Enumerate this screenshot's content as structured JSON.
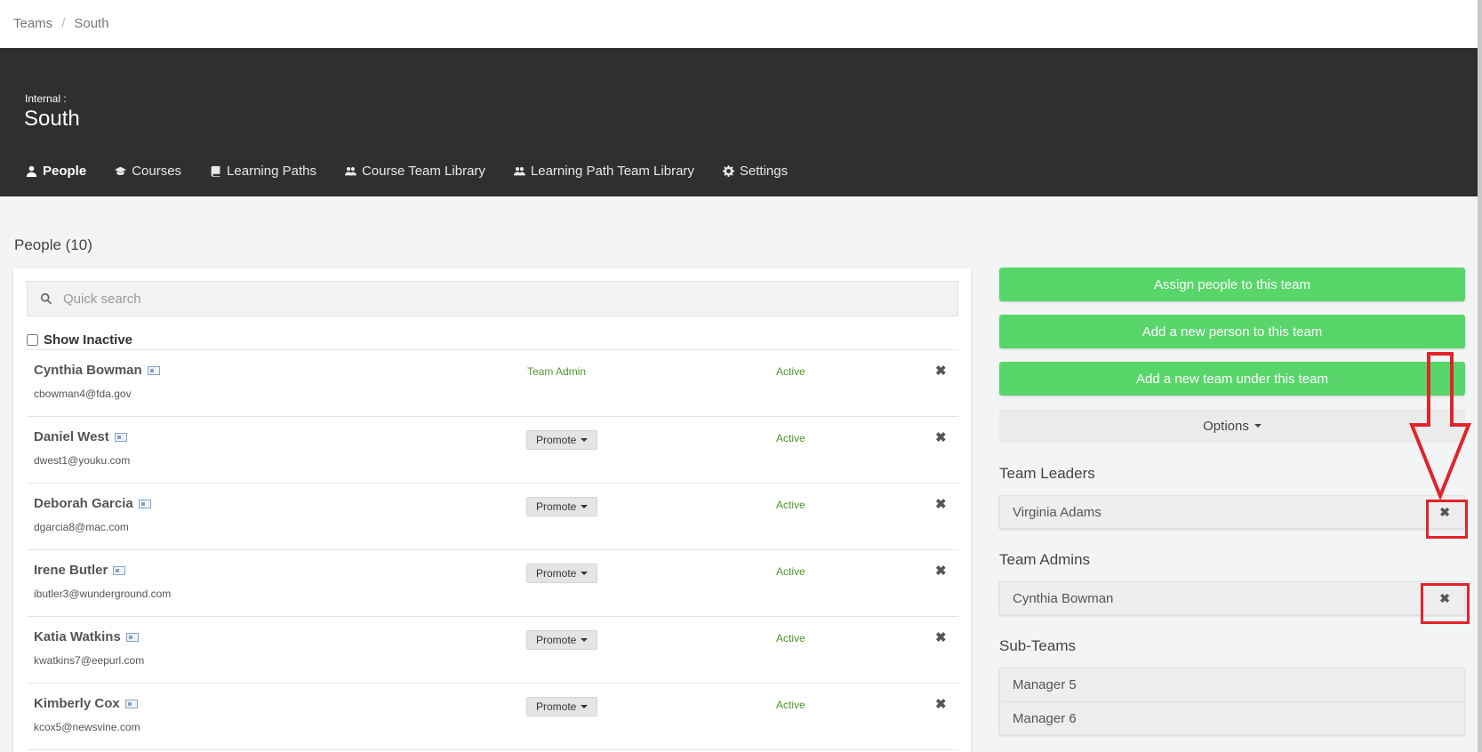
{
  "breadcrumb": {
    "items": [
      "Teams",
      "South"
    ],
    "separator": "/"
  },
  "header": {
    "subtitle": "Internal :",
    "title": "South",
    "tabs": [
      {
        "label": "People",
        "icon": "user-icon",
        "active": true
      },
      {
        "label": "Courses",
        "icon": "graduation-cap-icon"
      },
      {
        "label": "Learning Paths",
        "icon": "book-icon"
      },
      {
        "label": "Course Team Library",
        "icon": "users-icon"
      },
      {
        "label": "Learning Path Team Library",
        "icon": "users-icon"
      },
      {
        "label": "Settings",
        "icon": "gear-icon"
      }
    ]
  },
  "people": {
    "title": "People (10)",
    "search_placeholder": "Quick search",
    "show_inactive_label": "Show Inactive",
    "rows": [
      {
        "name": "Cynthia Bowman",
        "email": "cbowman4@fda.gov",
        "role": "Team Admin",
        "status": "Active"
      },
      {
        "name": "Daniel West",
        "email": "dwest1@youku.com",
        "promote": "Promote",
        "status": "Active"
      },
      {
        "name": "Deborah Garcia",
        "email": "dgarcia8@mac.com",
        "promote": "Promote",
        "status": "Active"
      },
      {
        "name": "Irene Butler",
        "email": "ibutler3@wunderground.com",
        "promote": "Promote",
        "status": "Active"
      },
      {
        "name": "Katia Watkins",
        "email": "kwatkins7@eepurl.com",
        "promote": "Promote",
        "status": "Active"
      },
      {
        "name": "Kimberly Cox",
        "email": "kcox5@newsvine.com",
        "promote": "Promote",
        "status": "Active"
      }
    ],
    "remove_glyph": "✖"
  },
  "sidebar": {
    "assign_label": "Assign people to this team",
    "add_person_label": "Add a new person to this team",
    "add_team_label": "Add a new team under this team",
    "options_label": "Options",
    "leaders_heading": "Team Leaders",
    "leaders": [
      "Virginia Adams"
    ],
    "admins_heading": "Team Admins",
    "admins": [
      "Cynthia Bowman"
    ],
    "subteams_heading": "Sub-Teams",
    "subteams": [
      "Manager 5",
      "Manager 6"
    ],
    "remove_glyph": "✖"
  },
  "colors": {
    "header_bg": "#2f2f2f",
    "green": "#58d66a",
    "active_text": "#4e9a2b",
    "annotation": "#e1242a"
  }
}
